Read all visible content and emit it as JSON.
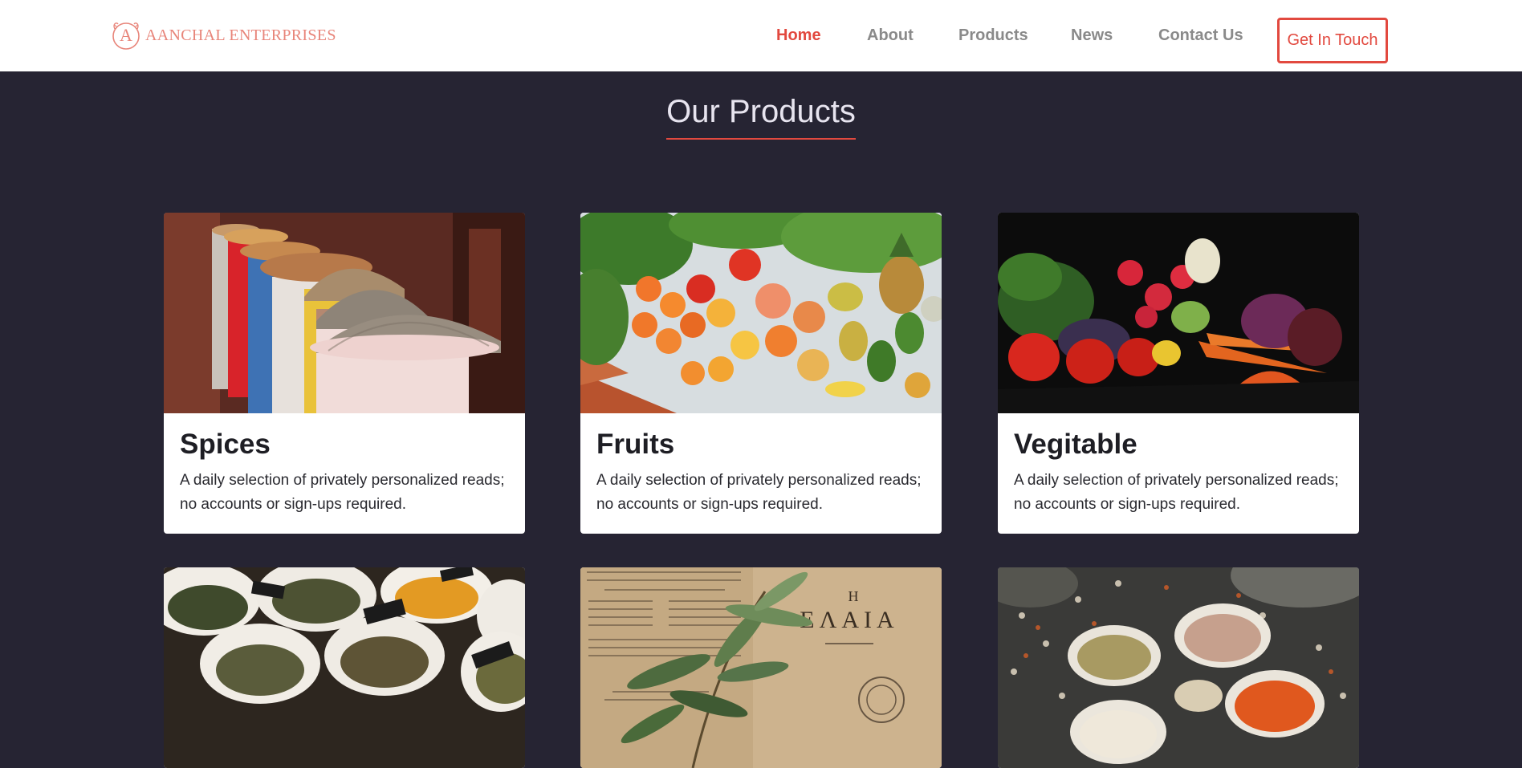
{
  "brand": {
    "logo_letter": "A",
    "name": "AANCHAL ENTERPRISES",
    "accent": "#e2493f"
  },
  "nav": {
    "items": [
      {
        "label": "Home",
        "active": true
      },
      {
        "label": "About",
        "active": false
      },
      {
        "label": "Products",
        "active": false
      },
      {
        "label": "News",
        "active": false
      },
      {
        "label": "Contact Us",
        "active": false
      }
    ],
    "cta_label": "Get In Touch"
  },
  "section": {
    "title": "Our Products"
  },
  "products": [
    {
      "title": "Spices",
      "description": "A daily selection of privately personalized reads; no accounts or sign-ups required.",
      "image": "spice-sacks-photo"
    },
    {
      "title": "Fruits",
      "description": "A daily selection of privately personalized reads; no accounts or sign-ups required.",
      "image": "fruits-vegetables-photo"
    },
    {
      "title": "Vegitable",
      "description": "A daily selection of privately personalized reads; no accounts or sign-ups required.",
      "image": "vegetables-dark-photo"
    },
    {
      "title": "",
      "description": "",
      "image": "labeled-spice-bags-photo"
    },
    {
      "title": "",
      "description": "",
      "image": "olive-branch-old-paper-photo"
    },
    {
      "title": "",
      "description": "",
      "image": "beans-lentils-bowls-photo"
    }
  ],
  "image_text": {
    "greek_word": "ΕΛΑΙΑ",
    "greek_letter": "Η"
  }
}
